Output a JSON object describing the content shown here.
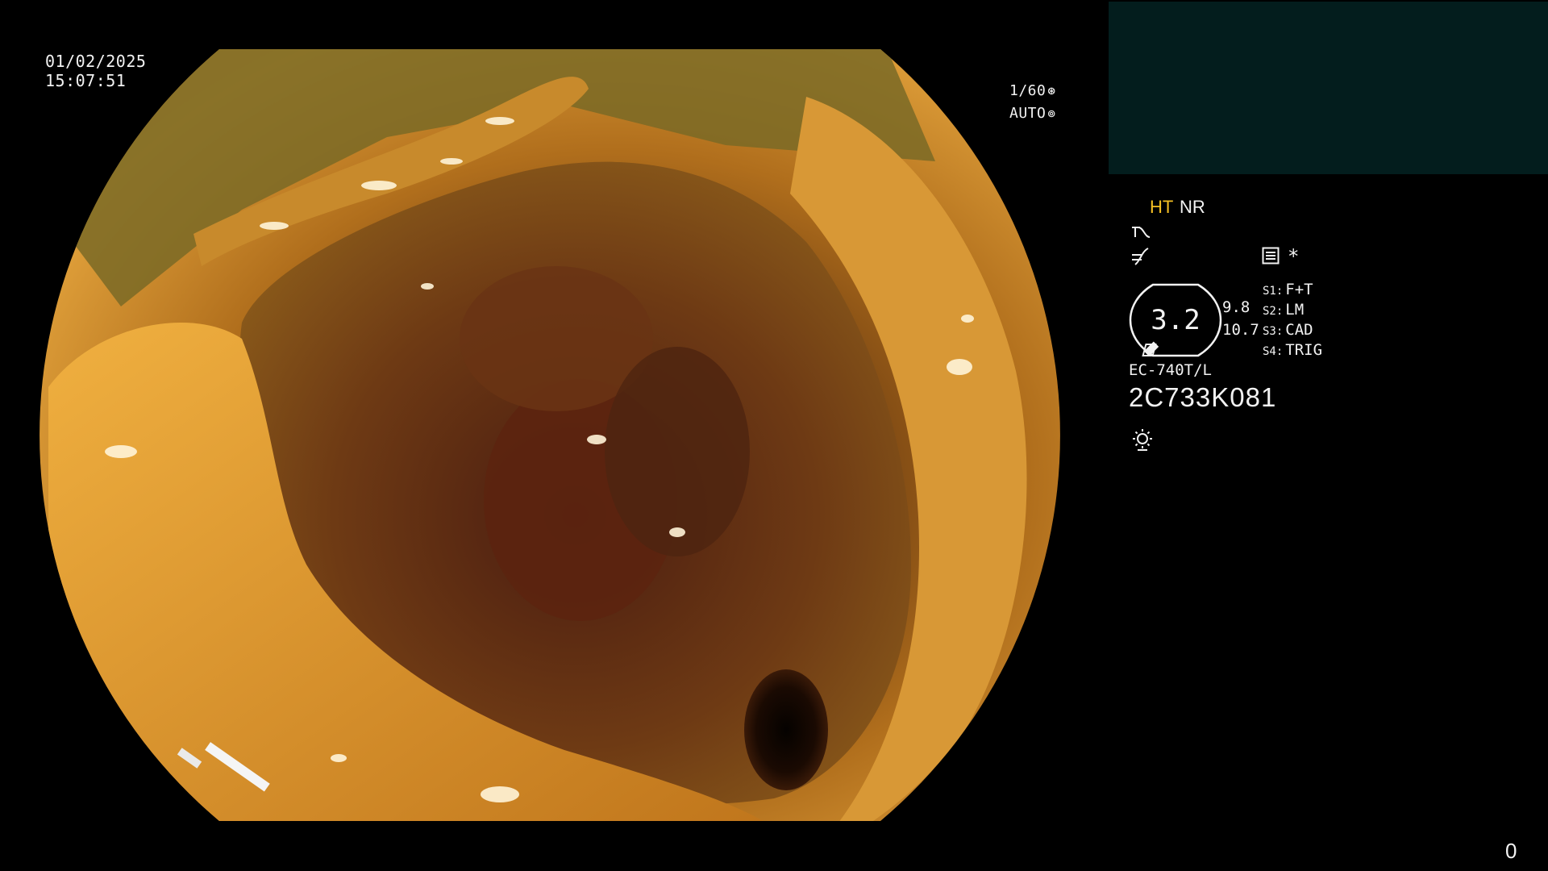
{
  "overlay": {
    "date": "01/02/2025",
    "time": "15:07:51",
    "shutter_speed": "1/60",
    "iris_mode": "AUTO",
    "shutter_icon": "aperture-icon",
    "iris_icon": "iris-icon"
  },
  "panel": {
    "enhancement_ht": "HT",
    "enhancement_nr": "NR",
    "ht_color": "#f5c023",
    "thumbnail_bg": "#031d1d",
    "zoom_value": "3.2",
    "zoom_readout_1": "9.8",
    "zoom_readout_2": "10.7",
    "asterisk": "*",
    "switches": [
      {
        "key": "S1:",
        "value": "F+T"
      },
      {
        "key": "S2:",
        "value": "LM"
      },
      {
        "key": "S3:",
        "value": "CAD"
      },
      {
        "key": "S4:",
        "value": "TRIG"
      }
    ],
    "scope_model": "EC-740T/L",
    "scope_serial": "2C733K081",
    "icons": [
      "tone-curve-icon",
      "gamma-curve-icon",
      "menu-icon",
      "zoom-ring-icon",
      "light-source-icon"
    ]
  },
  "frame_counter": "0"
}
